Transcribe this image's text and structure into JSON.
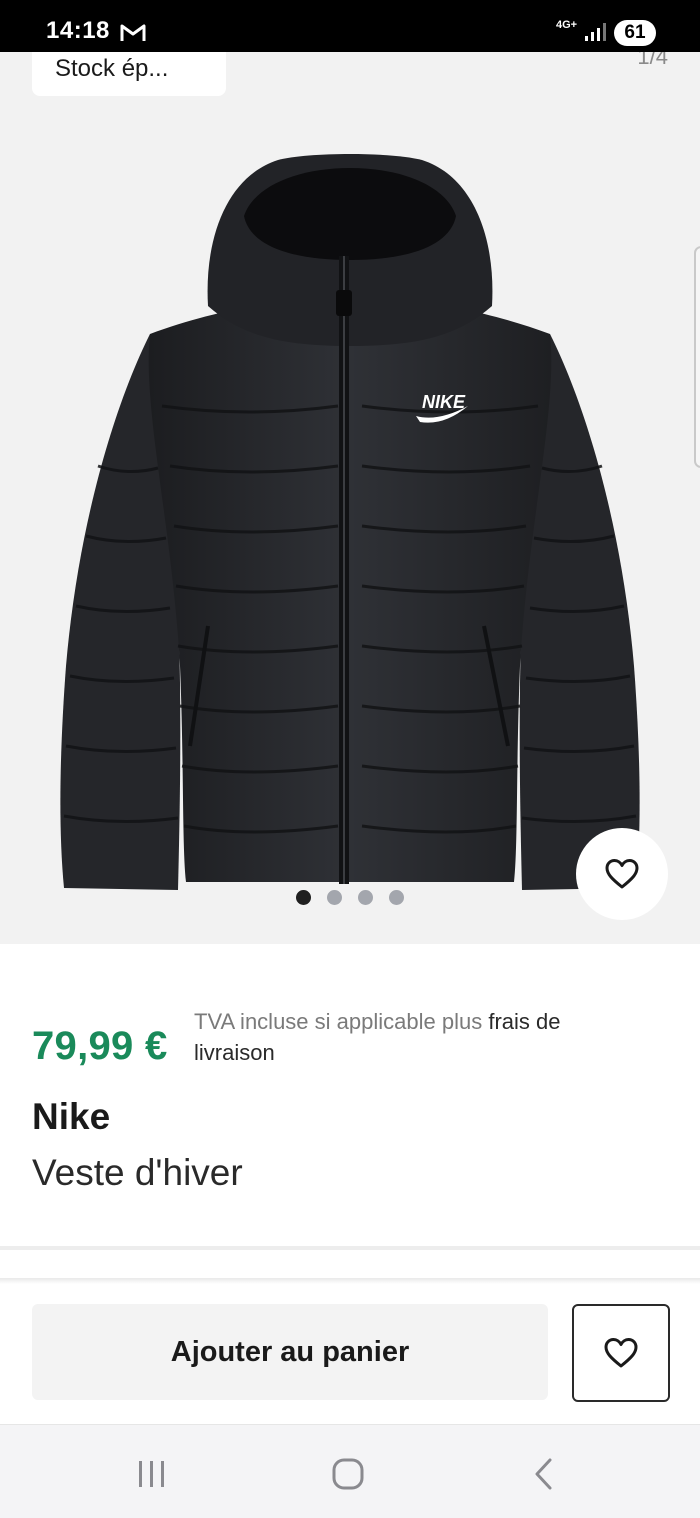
{
  "status_bar": {
    "time": "14:18",
    "network": "4G+",
    "battery": "61",
    "icons": [
      "gmail-icon",
      "signal-icon"
    ]
  },
  "gallery": {
    "stock_badge": "Stock ép...",
    "image_counter": "1/4",
    "image_subject": "black-puffer-jacket",
    "logo_text": "NIKE",
    "page_count": 4,
    "active_page": 1
  },
  "product": {
    "price": "79,99 €",
    "tax_note": "TVA incluse si applicable plus",
    "shipping_link": "frais de livraison",
    "brand": "Nike",
    "name": "Veste d'hiver",
    "price_color": "#1a8a5a"
  },
  "actions": {
    "add_to_cart": "Ajouter au panier",
    "wishlist_icon": "heart-icon"
  },
  "nav_bar": {
    "buttons": [
      "recents-icon",
      "home-icon",
      "back-icon"
    ]
  }
}
